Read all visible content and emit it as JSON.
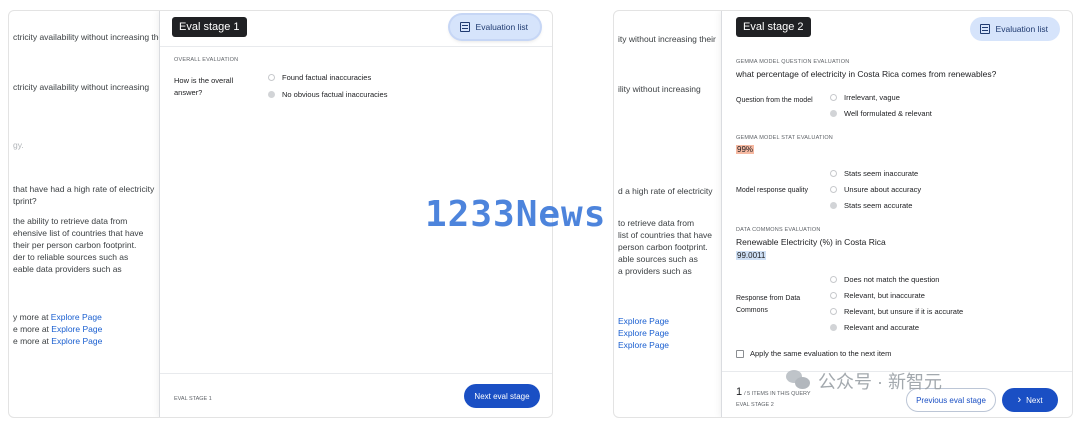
{
  "left": {
    "bg_lines": [
      "ctricity availability without increasing their",
      "ctricity availability without increasing",
      "gy.",
      "that have had a high rate of electricity",
      "tprint?",
      "the ability to retrieve data from",
      "ehensive list of countries that have",
      "their per person carbon footprint.",
      "der to reliable sources such as",
      "eable data providers such as"
    ],
    "explore_lines": [
      {
        "prefix": "y more at ",
        "link": "Explore Page"
      },
      {
        "prefix": "e more at ",
        "link": "Explore Page"
      },
      {
        "prefix": "e more at ",
        "link": "Explore Page"
      }
    ],
    "stage_chip": "Eval stage 1",
    "eval_list_label": "Evaluation list",
    "section_label": "OVERALL EVALUATION",
    "question": "How is the overall answer?",
    "options": [
      "Found factual inaccuracies",
      "No obvious factual inaccuracies"
    ],
    "selected_option": 1,
    "footer_label": "EVAL STAGE 1",
    "next_label": "Next eval stage"
  },
  "right": {
    "bg_lines": [
      "ity without increasing their",
      "ility without increasing",
      "d a high rate of electricity",
      "to retrieve data from",
      "list of countries that have",
      "person carbon footprint.",
      "able sources such as",
      "a providers such as"
    ],
    "explore_links": [
      "Explore Page",
      "Explore Page",
      "Explore Page"
    ],
    "stage_chip": "Eval stage 2",
    "eval_list_label": "Evaluation list",
    "question_section_label": "GEMMA MODEL QUESTION EVALUATION",
    "model_question": "what percentage of electricity in Costa Rica comes from renewables?",
    "q1_label": "Question from the model",
    "q1_options": [
      "Irrelevant, vague",
      "Well formulated & relevant"
    ],
    "q1_selected": 1,
    "stat_section_label": "GEMMA MODEL STAT EVALUATION",
    "stat_value": "99%",
    "q2_label": "Model response quality",
    "q2_options": [
      "Stats seem inaccurate",
      "Unsure about accuracy",
      "Stats seem accurate"
    ],
    "q2_selected": 2,
    "dc_section_label": "DATA COMMONS EVALUATION",
    "dc_title": "Renewable Electricity (%) in Costa Rica",
    "dc_value": "99.0011",
    "q3_label": "Response from Data Commons",
    "q3_options": [
      "Does not match the question",
      "Relevant, but inaccurate",
      "Relevant, but unsure if it is accurate",
      "Relevant and accurate"
    ],
    "q3_selected": 3,
    "checkbox_label": "Apply the same evaluation to the next item",
    "footer_count": "1",
    "footer_items": "/ 5 ITEMS IN THIS QUERY",
    "footer_stage": "EVAL STAGE 2",
    "prev_label": "Previous eval stage",
    "next_label": "Next",
    "next_icon": "›"
  },
  "watermark": "1233News",
  "wechat_text": "公众号 · 新智元",
  "colors": {
    "primary": "#1a4fc4",
    "chip_bg": "#d6e4fb",
    "orange_highlight": "#f6b9a2",
    "blue_highlight": "#cfe0f5"
  }
}
